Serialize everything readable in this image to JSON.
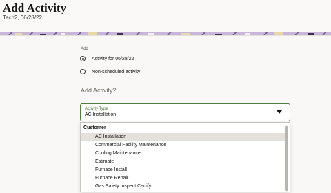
{
  "header": {
    "title": "Add Activity",
    "subtitle": "Tech2, 06/28/22"
  },
  "form": {
    "add_label": "Add",
    "radios": [
      {
        "label": "Activity for 06/28/22",
        "checked": true
      },
      {
        "label": "Non-scheduled activity",
        "checked": false
      }
    ],
    "section_heading": "Add Activity?",
    "activity_type": {
      "label": "Activity Type",
      "value": "AC Installation"
    }
  },
  "dropdown": {
    "group": "Customer",
    "options": [
      "AC Installation",
      "Commercial Facility Maintenance",
      "Cooling Maintenance",
      "Estimate",
      "Furnace Install",
      "Furnace Repair",
      "Gas Safety Inspect Certify"
    ],
    "selected_index": 0
  },
  "colors": {
    "accent": "#4f7d3f",
    "banner_purple": "#b9a3cf",
    "banner_yellow": "#e9d9a8"
  }
}
